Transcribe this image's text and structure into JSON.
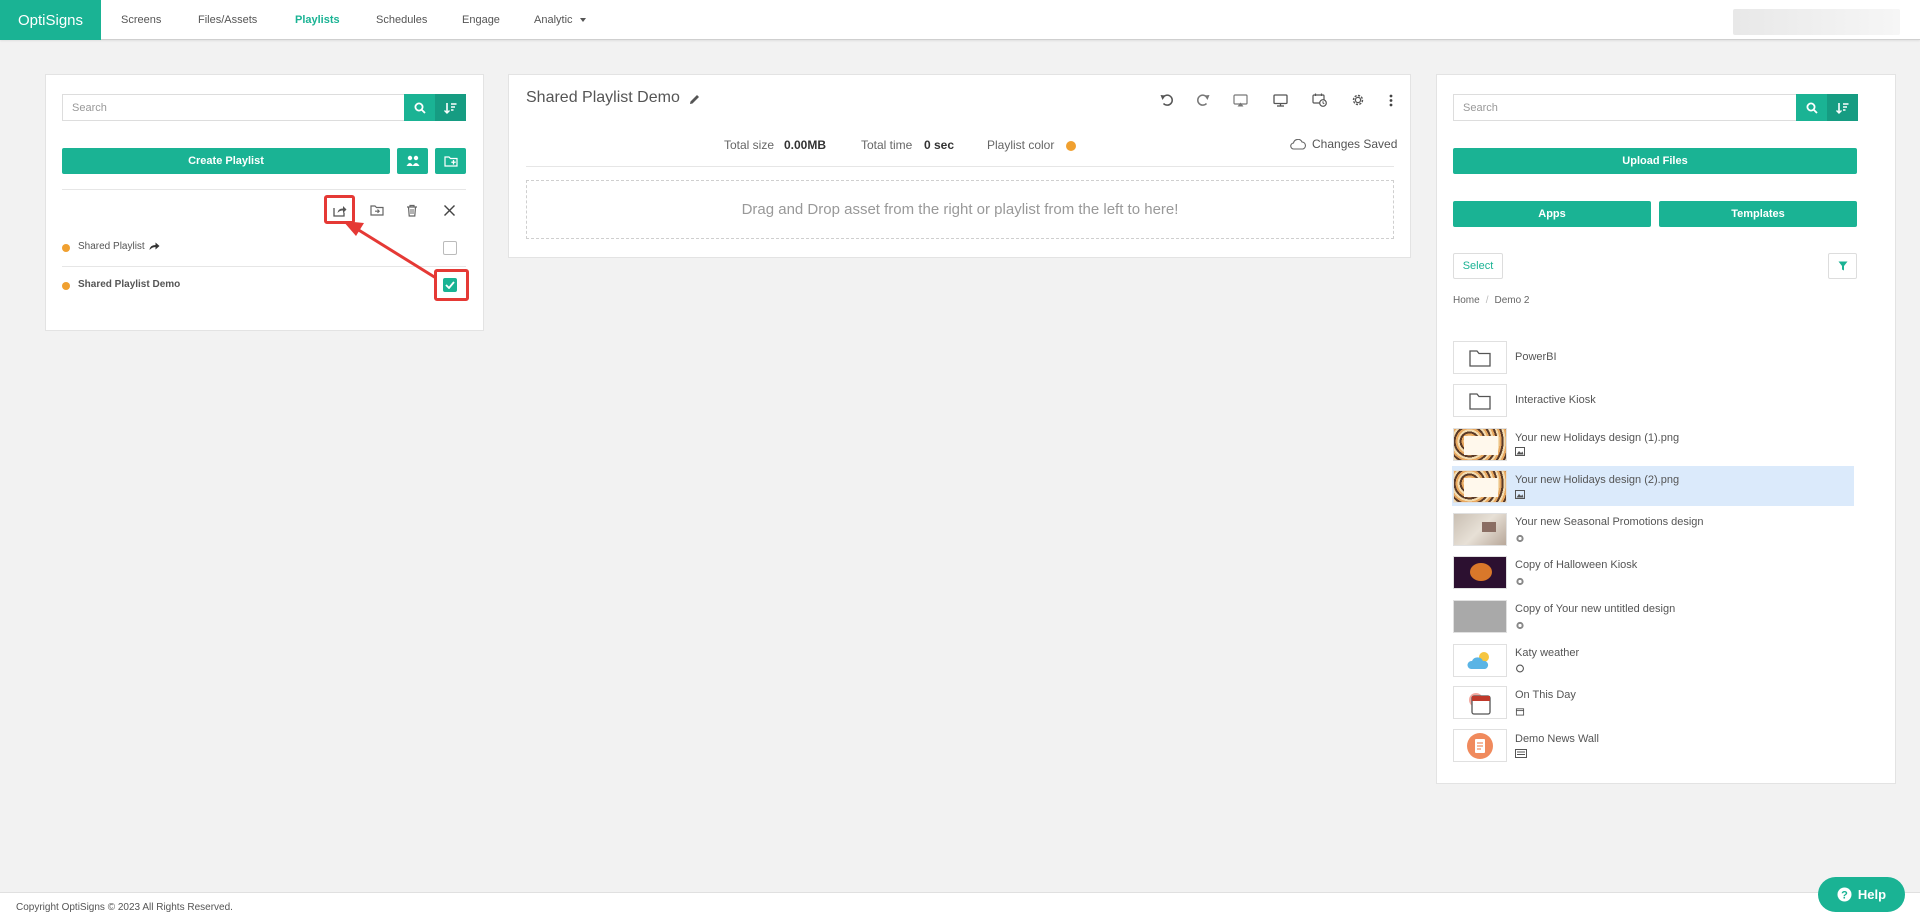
{
  "nav": {
    "logo": "OptiSigns",
    "items": [
      "Screens",
      "Files/Assets",
      "Playlists",
      "Schedules",
      "Engage",
      "Analytic"
    ],
    "active": "Playlists"
  },
  "left": {
    "search_placeholder": "Search",
    "create_label": "Create Playlist",
    "playlists": [
      {
        "name": "Shared Playlist",
        "shared": true,
        "checked": false
      },
      {
        "name": "Shared Playlist Demo",
        "shared": false,
        "checked": true
      }
    ]
  },
  "editor": {
    "title": "Shared Playlist Demo",
    "total_size_label": "Total size",
    "total_size": "0.00MB",
    "total_time_label": "Total time",
    "total_time": "0 sec",
    "color_label": "Playlist color",
    "saved_status": "Changes Saved",
    "drop_hint": "Drag and Drop asset from the right or playlist from the left to here!"
  },
  "right": {
    "search_placeholder": "Search",
    "upload_label": "Upload Files",
    "apps_label": "Apps",
    "templates_label": "Templates",
    "select_label": "Select",
    "breadcrumb": [
      "Home",
      "Demo 2"
    ],
    "assets": [
      {
        "name": "PowerBI",
        "kind": "folder"
      },
      {
        "name": "Interactive Kiosk",
        "kind": "folder"
      },
      {
        "name": "Your new Holidays design (1).png",
        "kind": "image"
      },
      {
        "name": "Your new Holidays design (2).png",
        "kind": "image"
      },
      {
        "name": "Your new Seasonal Promotions design",
        "kind": "design"
      },
      {
        "name": "Copy of Halloween Kiosk",
        "kind": "design"
      },
      {
        "name": "Copy of Your new untitled design",
        "kind": "design"
      },
      {
        "name": "Katy weather",
        "kind": "app"
      },
      {
        "name": "On This Day",
        "kind": "app"
      },
      {
        "name": "Demo News Wall",
        "kind": "app"
      }
    ]
  },
  "footer": {
    "copyright": "Copyright OptiSigns © 2023 All Rights Reserved.",
    "help_label": "Help"
  },
  "colors": {
    "accent": "#1ab394",
    "playlist_dot": "#f0a030",
    "highlight": "#e53935",
    "selected_row": "#dbeafb"
  }
}
